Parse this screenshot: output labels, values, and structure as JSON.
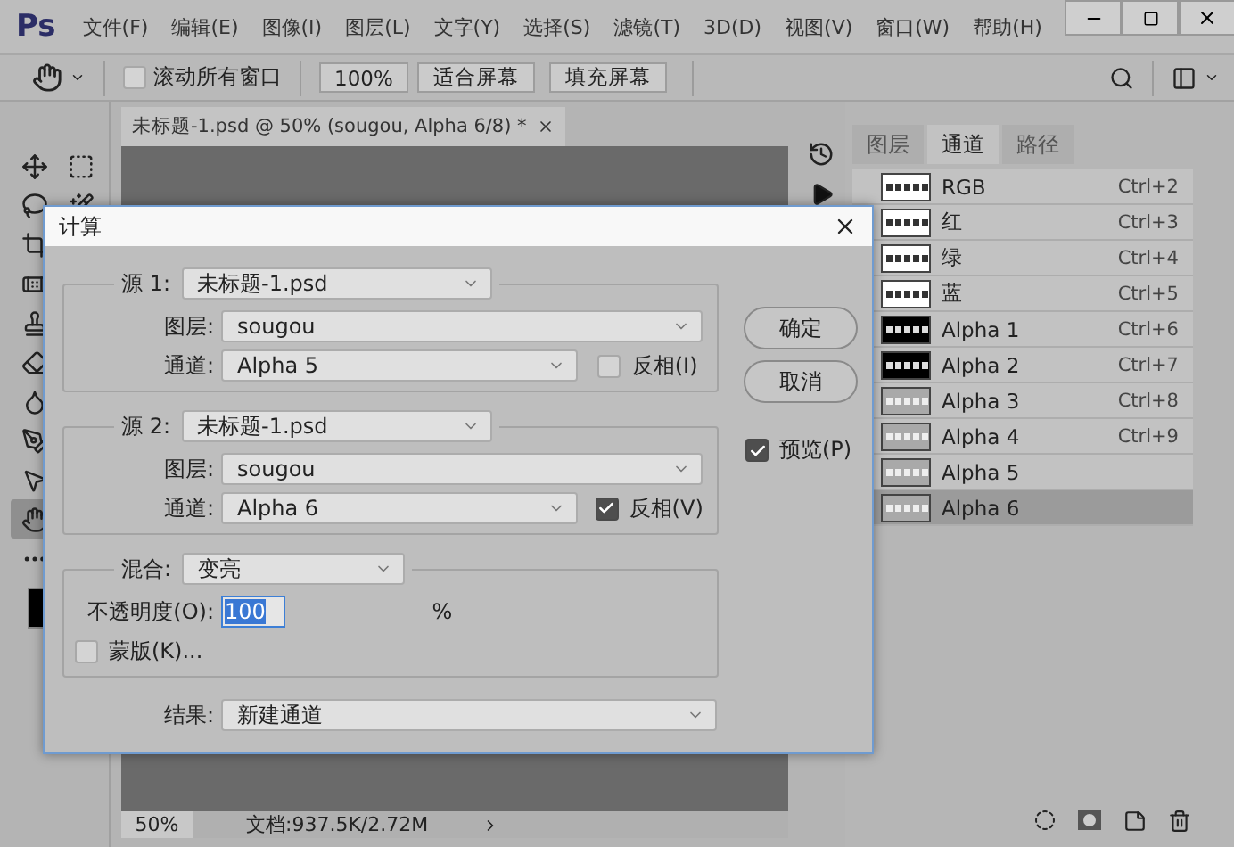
{
  "menu_bar": {
    "logo": "Ps",
    "items": [
      "文件(F)",
      "编辑(E)",
      "图像(I)",
      "图层(L)",
      "文字(Y)",
      "选择(S)",
      "滤镜(T)",
      "3D(D)",
      "视图(V)",
      "窗口(W)",
      "帮助(H)"
    ]
  },
  "options_bar": {
    "scroll_all": {
      "label": "滚动所有窗口",
      "checked": false
    },
    "buttons": [
      "100%",
      "适合屏幕",
      "填充屏幕"
    ]
  },
  "tools": [
    {
      "kind": "move",
      "selected": false
    },
    {
      "kind": "marquee",
      "selected": false
    },
    {
      "kind": "lasso",
      "selected": false
    },
    {
      "kind": "wand",
      "selected": false
    },
    {
      "kind": "crop",
      "selected": false
    },
    {
      "kind": "healing",
      "selected": false
    },
    {
      "kind": "stamp",
      "selected": false
    },
    {
      "kind": "eraser",
      "selected": false
    },
    {
      "kind": "blur",
      "selected": false
    },
    {
      "kind": "pen",
      "selected": false
    },
    {
      "kind": "pointer",
      "selected": false
    },
    {
      "kind": "hand",
      "selected": true
    },
    {
      "kind": "more",
      "selected": false
    }
  ],
  "document": {
    "tab": "未标题-1.psd @ 50% (sougou, Alpha 6/8) *",
    "zoom": "50%",
    "info": "文档:937.5K/2.72M"
  },
  "panel": {
    "tabs": [
      {
        "label": "图层",
        "selected": false
      },
      {
        "label": "通道",
        "selected": true
      },
      {
        "label": "路径",
        "selected": false
      }
    ],
    "channels": [
      {
        "name": "RGB",
        "shortcut": "Ctrl+2",
        "kind": "white",
        "selected": false
      },
      {
        "name": "红",
        "shortcut": "Ctrl+3",
        "kind": "white",
        "selected": false
      },
      {
        "name": "绿",
        "shortcut": "Ctrl+4",
        "kind": "white",
        "selected": false
      },
      {
        "name": "蓝",
        "shortcut": "Ctrl+5",
        "kind": "white",
        "selected": false
      },
      {
        "name": "Alpha 1",
        "shortcut": "Ctrl+6",
        "kind": "black",
        "selected": false
      },
      {
        "name": "Alpha 2",
        "shortcut": "Ctrl+7",
        "kind": "black",
        "selected": false
      },
      {
        "name": "Alpha 3",
        "shortcut": "Ctrl+8",
        "kind": "gray",
        "selected": false
      },
      {
        "name": "Alpha 4",
        "shortcut": "Ctrl+9",
        "kind": "gray",
        "selected": false
      },
      {
        "name": "Alpha 5",
        "kind": "gray",
        "selected": false
      },
      {
        "name": "Alpha 6",
        "kind": "gray",
        "selected": true
      }
    ]
  },
  "dialog": {
    "title": "计算",
    "ok": "确定",
    "cancel": "取消",
    "preview": {
      "label": "预览(P)",
      "checked": true
    },
    "sources": [
      {
        "label": "源 1:",
        "file": "未标题-1.psd",
        "layer_label": "图层:",
        "layer": "sougou",
        "channel_label": "通道:",
        "channel": "Alpha 5",
        "invert": {
          "label": "反相(I)",
          "checked": false
        }
      },
      {
        "label": "源 2:",
        "file": "未标题-1.psd",
        "layer_label": "图层:",
        "layer": "sougou",
        "channel_label": "通道:",
        "channel": "Alpha 6",
        "invert": {
          "label": "反相(V)",
          "checked": true
        }
      }
    ],
    "blend": {
      "label": "混合:",
      "mode": "变亮",
      "opacity_label": "不透明度(O):",
      "opacity": "100",
      "unit": "%",
      "mask": {
        "label": "蒙版(K)...",
        "checked": false
      }
    },
    "result": {
      "label": "结果:",
      "value": "新建通道"
    }
  }
}
